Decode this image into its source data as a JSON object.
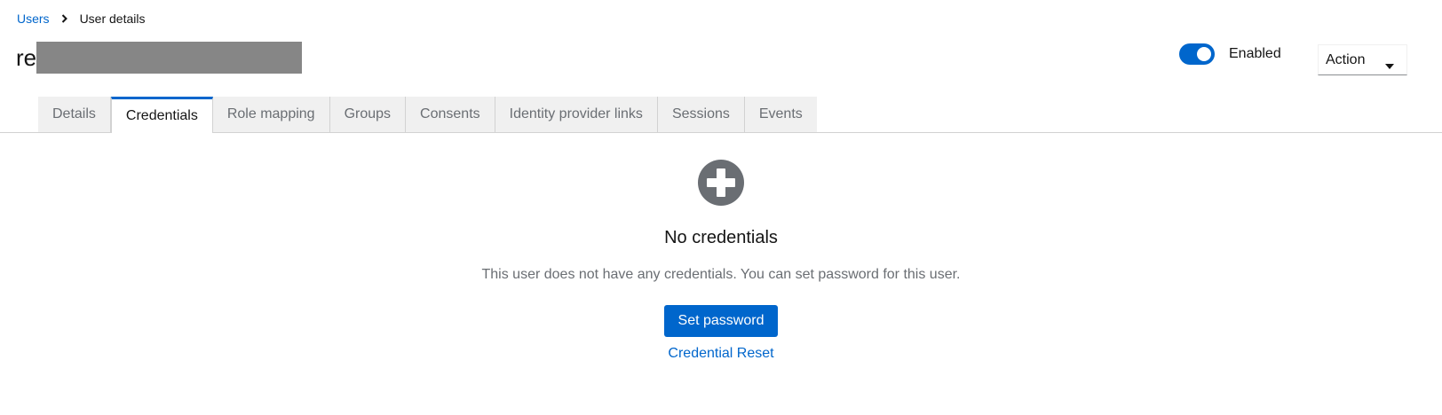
{
  "breadcrumb": {
    "parent": "Users",
    "current": "User details"
  },
  "header": {
    "title_prefix": "re",
    "enabled_label": "Enabled",
    "enabled": true,
    "action_label": "Action"
  },
  "tabs": [
    {
      "label": "Details",
      "active": false
    },
    {
      "label": "Credentials",
      "active": true
    },
    {
      "label": "Role mapping",
      "active": false
    },
    {
      "label": "Groups",
      "active": false
    },
    {
      "label": "Consents",
      "active": false
    },
    {
      "label": "Identity provider links",
      "active": false
    },
    {
      "label": "Sessions",
      "active": false
    },
    {
      "label": "Events",
      "active": false
    }
  ],
  "empty_state": {
    "icon": "plus-circle-icon",
    "title": "No credentials",
    "body": "This user does not have any credentials. You can set password for this user.",
    "primary_action": "Set password",
    "secondary_action": "Credential Reset"
  },
  "colors": {
    "accent": "#0066cc",
    "icon_gray": "#6a6e73",
    "tab_inactive_bg": "#f0f0f0"
  }
}
